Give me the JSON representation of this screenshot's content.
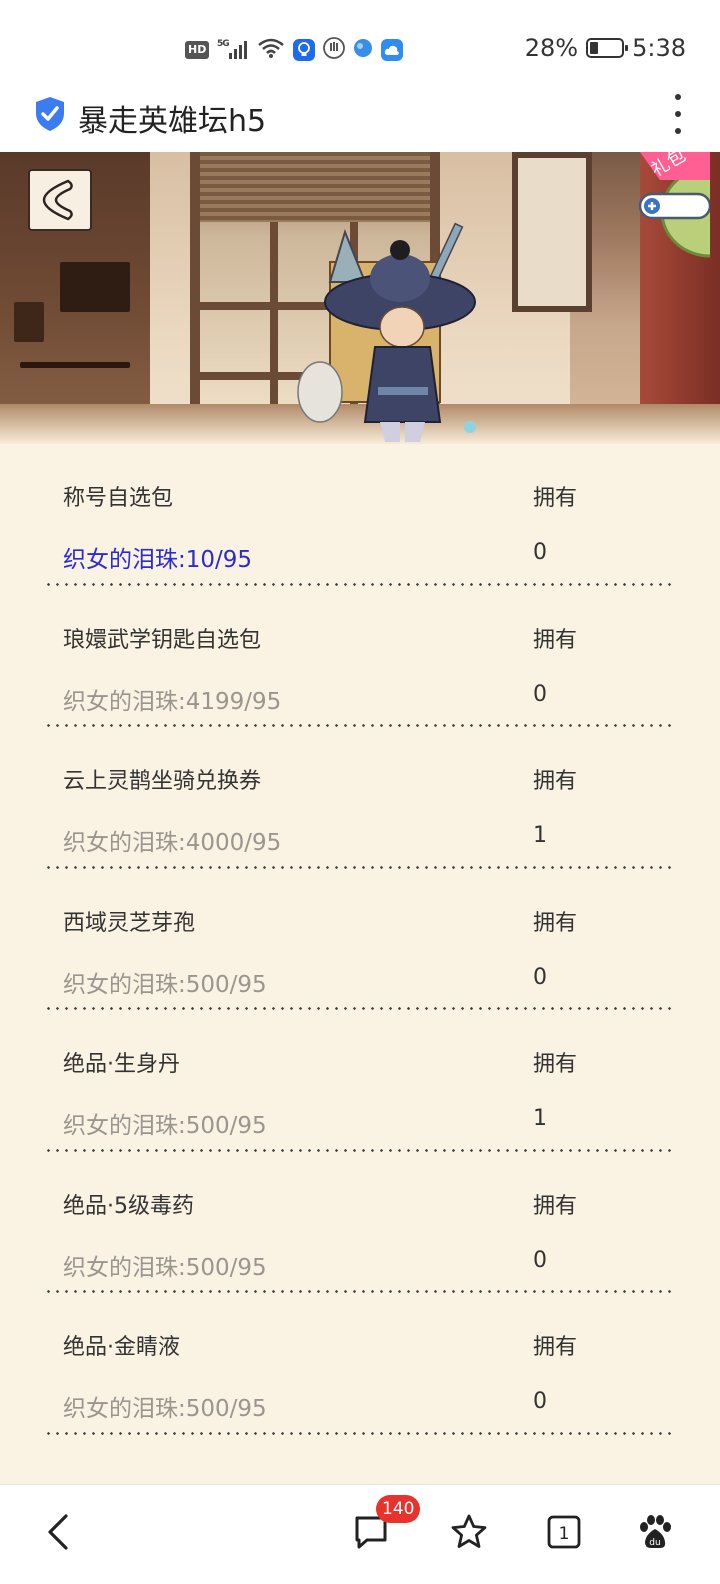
{
  "status_bar": {
    "network": "5G",
    "hd_label": "HD",
    "battery_percent": "28%",
    "battery_level": 0.28,
    "time": "5:38"
  },
  "browser": {
    "page_title": "暴走英雄坛h5"
  },
  "banner": {
    "gift_label": "礼包"
  },
  "list": {
    "items": [
      {
        "name": "称号自选包",
        "owned_label": "拥有",
        "cost": "织女的泪珠:10/95",
        "owned_count": "0",
        "affordable": true
      },
      {
        "name": "琅嬛武学钥匙自选包",
        "owned_label": "拥有",
        "cost": "织女的泪珠:4199/95",
        "owned_count": "0",
        "affordable": false
      },
      {
        "name": "云上灵鹊坐骑兑换券",
        "owned_label": "拥有",
        "cost": "织女的泪珠:4000/95",
        "owned_count": "1",
        "affordable": false
      },
      {
        "name": "西域灵芝芽孢",
        "owned_label": "拥有",
        "cost": "织女的泪珠:500/95",
        "owned_count": "0",
        "affordable": false
      },
      {
        "name": "绝品·生身丹",
        "owned_label": "拥有",
        "cost": "织女的泪珠:500/95",
        "owned_count": "1",
        "affordable": false
      },
      {
        "name": "绝品·5级毒药",
        "owned_label": "拥有",
        "cost": "织女的泪珠:500/95",
        "owned_count": "0",
        "affordable": false
      },
      {
        "name": "绝品·金睛液",
        "owned_label": "拥有",
        "cost": "织女的泪珠:500/95",
        "owned_count": "0",
        "affordable": false
      }
    ]
  },
  "bottom_nav": {
    "messages_badge": "140",
    "tabs_count": "1"
  }
}
